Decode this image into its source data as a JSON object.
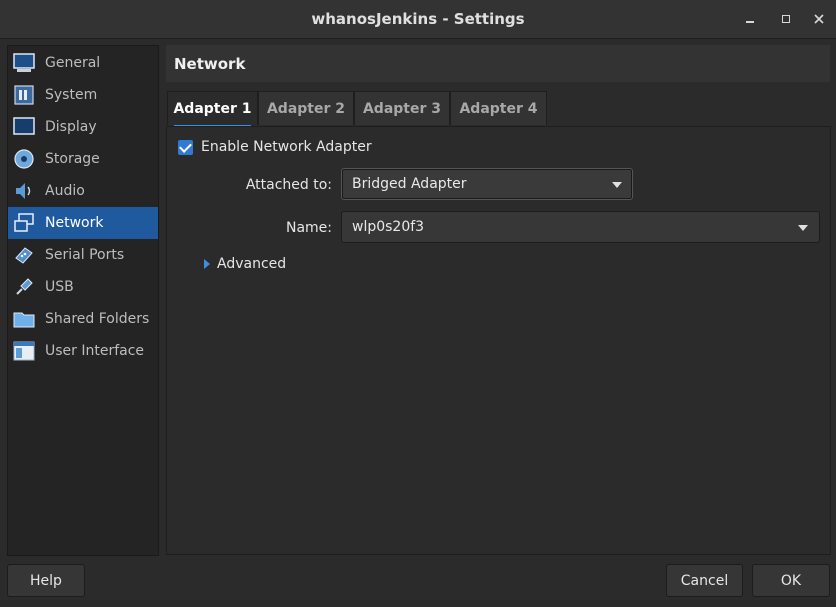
{
  "window": {
    "title": "whanosJenkins - Settings"
  },
  "sidebar": {
    "items": [
      {
        "label": "General",
        "icon": "monitor-icon"
      },
      {
        "label": "System",
        "icon": "chip-icon"
      },
      {
        "label": "Display",
        "icon": "display-icon"
      },
      {
        "label": "Storage",
        "icon": "disk-icon"
      },
      {
        "label": "Audio",
        "icon": "speaker-icon"
      },
      {
        "label": "Network",
        "icon": "network-icon",
        "active": true
      },
      {
        "label": "Serial Ports",
        "icon": "serial-icon"
      },
      {
        "label": "USB",
        "icon": "usb-icon"
      },
      {
        "label": "Shared Folders",
        "icon": "folder-icon"
      },
      {
        "label": "User Interface",
        "icon": "window-icon"
      }
    ]
  },
  "panel": {
    "title": "Network",
    "tabs": [
      "Adapter 1",
      "Adapter 2",
      "Adapter 3",
      "Adapter 4"
    ],
    "enable_label": "Enable Network Adapter",
    "enable_checked": true,
    "attached_label": "Attached to:",
    "attached_value": "Bridged Adapter",
    "name_label": "Name:",
    "name_value": "wlp0s20f3",
    "advanced_label": "Advanced"
  },
  "buttons": {
    "help": "Help",
    "cancel": "Cancel",
    "ok": "OK"
  },
  "colors": {
    "accent": "#1f5a9e",
    "checkbox": "#2f7bd4"
  }
}
